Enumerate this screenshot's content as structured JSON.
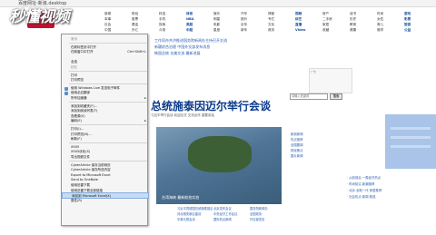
{
  "window": {
    "title": "百度网址-新浪.desktop"
  },
  "watermark": {
    "text": "秒懂视频"
  },
  "nav": {
    "columns": [
      [
        "新闻",
        "军事",
        "社会",
        "中国"
      ],
      [
        "财经",
        "股票",
        "基金",
        "外汇"
      ],
      [
        "科技",
        "手机",
        "探索",
        "众测"
      ],
      [
        "体育",
        "NBA",
        "英超",
        "中超"
      ],
      [
        "娱乐",
        "明星",
        "电影",
        "星座"
      ],
      [
        "汽车",
        "报价",
        "买车",
        "新车"
      ],
      [
        "博客",
        "专栏",
        "文化",
        "政务"
      ],
      [
        "视频",
        "综艺",
        "直播",
        "Video"
      ],
      [
        "房产",
        "二手房",
        "家居",
        "收藏"
      ],
      [
        "读书",
        "历史",
        "教育",
        "健康"
      ],
      [
        "时尚",
        "女性",
        "育儿",
        "佛学"
      ],
      [
        "游戏",
        "彩票",
        "旅游",
        "公益"
      ]
    ]
  },
  "top_headlines": [
    "工作同舟共济推进国务院新闻办主持召开交流",
    "新疆综合治理 中国外交部发布消息",
    "韩国总统 访美交流 最新进展"
  ],
  "main": {
    "headline": "总统施泰因迈尔举行会谈",
    "sub": "习近平举行会谈 欢迎仪式 交流合作 重要讲话",
    "photo_caption": "台湾海峡 最新航拍实拍",
    "left_news": [
      "国际",
      "国内",
      "财经",
      "体育",
      "要闻",
      "娱乐",
      "社会",
      "科技"
    ],
    "bottom_links": [
      "习近平同德国总统施泰因迈尔会谈",
      "北京发布会议",
      "国务院新闻办",
      "河北雄安新区建设",
      "中央经济工作会议",
      "全国政协",
      "中美元首会谈",
      "国际热点新闻",
      "外交部发言"
    ]
  },
  "search": {
    "placeholder": "请输入关键词",
    "button": "搜索"
  },
  "ad_label": "广告",
  "right_links": [
    "新浪新闻",
    "热点推荐",
    "全国要闻",
    "财经焦点",
    "图片新闻"
  ],
  "right_news": [
    "· 从前到后 一周经济热点",
    "· 时尚前沿 新潮推荐",
    "· 北京 全新一代 家居推荐",
    "· 社会热点 新闻 精选"
  ],
  "left_bg_links": [
    "红",
    "大",
    "要",
    "闻"
  ],
  "context_menu": {
    "items": [
      {
        "type": "item",
        "label": "撤消",
        "shortcut": "",
        "disabled": true
      },
      {
        "type": "sep"
      },
      {
        "type": "item",
        "label": "在新标签页中打开",
        "shortcut": "",
        "disabled": false
      },
      {
        "type": "item",
        "label": "在新窗口中打开",
        "shortcut": "Ctrl+Shift+L",
        "disabled": false
      },
      {
        "type": "item",
        "label": "",
        "shortcut": "",
        "disabled": false
      },
      {
        "type": "item",
        "label": "全选",
        "shortcut": "",
        "disabled": false
      },
      {
        "type": "item",
        "label": "粘贴",
        "shortcut": "",
        "disabled": true
      },
      {
        "type": "sep"
      },
      {
        "type": "item",
        "label": "打印",
        "shortcut": "",
        "disabled": false
      },
      {
        "type": "item",
        "label": "打印预览",
        "shortcut": "",
        "disabled": false
      },
      {
        "type": "sep"
      },
      {
        "type": "item",
        "label": "使用 Windows Live 发送电子邮件",
        "shortcut": "",
        "disabled": false,
        "icon": true
      },
      {
        "type": "item",
        "label": "使用必应翻译",
        "shortcut": "",
        "disabled": false,
        "icon": true
      },
      {
        "type": "item",
        "label": "所有加速器",
        "shortcut": "",
        "disabled": false,
        "arrow": true
      },
      {
        "type": "sep"
      },
      {
        "type": "item",
        "label": "添加到收藏夹(F)...",
        "shortcut": "",
        "disabled": false
      },
      {
        "type": "item",
        "label": "添加到阅读列表(T)",
        "shortcut": "",
        "disabled": false
      },
      {
        "type": "item",
        "label": "查看源(V)",
        "shortcut": "",
        "disabled": false
      },
      {
        "type": "item",
        "label": "编码(E)",
        "shortcut": "",
        "disabled": false,
        "arrow": true
      },
      {
        "type": "sep"
      },
      {
        "type": "item",
        "label": "打印(I)...",
        "shortcut": "",
        "disabled": false
      },
      {
        "type": "item",
        "label": "打印预览(N)...",
        "shortcut": "",
        "disabled": false
      },
      {
        "type": "item",
        "label": "刷新(F)",
        "shortcut": "",
        "disabled": false
      },
      {
        "type": "sep"
      },
      {
        "type": "item",
        "label": "X5X5",
        "shortcut": "",
        "disabled": false
      },
      {
        "type": "item",
        "label": "X5X5优化(S)",
        "shortcut": "",
        "disabled": false
      },
      {
        "type": "item",
        "label": "导出视频文件",
        "shortcut": "",
        "disabled": false
      },
      {
        "type": "sep"
      },
      {
        "type": "item",
        "label": "CyberArticle 保存当前网页",
        "shortcut": "",
        "disabled": false
      },
      {
        "type": "item",
        "label": "CyberArticle 保存所选内容",
        "shortcut": "",
        "disabled": false
      },
      {
        "type": "item",
        "label": "Export to Microsoft Excel",
        "shortcut": "",
        "disabled": false
      },
      {
        "type": "item",
        "label": "Send to OneNote",
        "shortcut": "",
        "disabled": false
      },
      {
        "type": "item",
        "label": "使用迅雷下载",
        "shortcut": "",
        "disabled": false
      },
      {
        "type": "item",
        "label": "使用迅雷下载全部链接",
        "shortcut": "",
        "disabled": false
      },
      {
        "type": "item",
        "label": "添加到 Microsoft Excel(X)",
        "shortcut": "",
        "disabled": false,
        "highlight": true
      },
      {
        "type": "item",
        "label": "属性(R)",
        "shortcut": "",
        "disabled": false
      }
    ]
  }
}
